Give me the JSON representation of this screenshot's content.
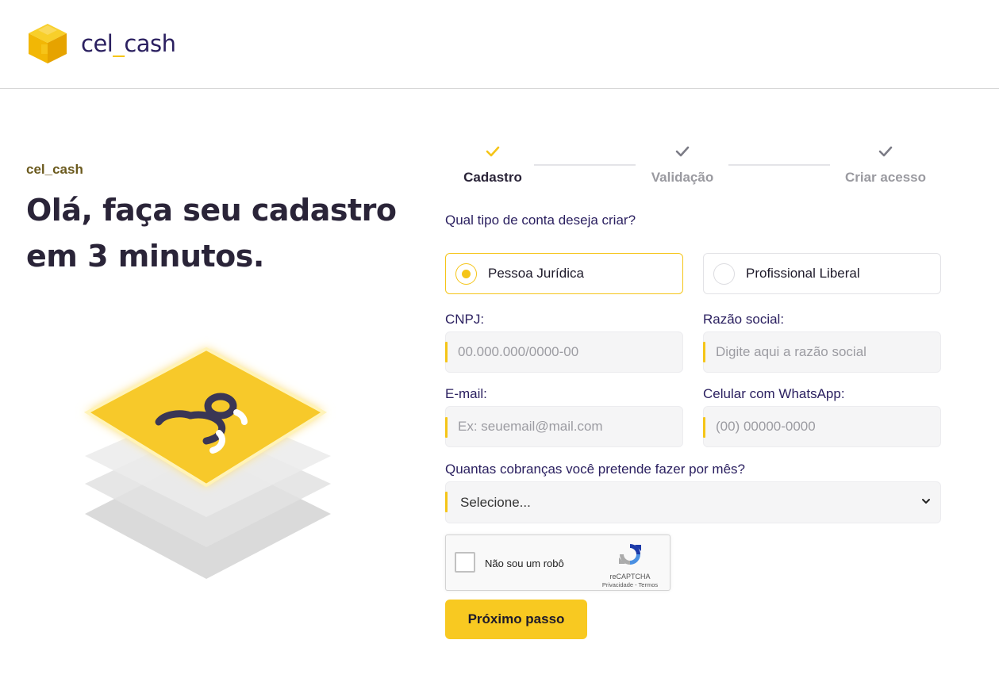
{
  "header": {
    "logo": {
      "text_left": "cel",
      "text_sep": "_",
      "text_right": "cash",
      "icon": "cube-logo-icon",
      "brand_color": "#f5c518"
    }
  },
  "hero": {
    "eyebrow": "cel_cash",
    "headline_line1": "Olá, faça seu cadastro",
    "headline_line2": "em 3 minutos.",
    "illustration": "stacked-card-illustration"
  },
  "stepper": {
    "steps": [
      {
        "label": "Cadastro",
        "state": "active",
        "icon": "check-icon"
      },
      {
        "label": "Validação",
        "state": "inactive",
        "icon": "check-icon"
      },
      {
        "label": "Criar acesso",
        "state": "inactive",
        "icon": "check-icon"
      }
    ]
  },
  "form": {
    "account_type_question": "Qual tipo de conta deseja criar?",
    "account_types": [
      {
        "label": "Pessoa Jurídica",
        "selected": true
      },
      {
        "label": "Profissional Liberal",
        "selected": false
      }
    ],
    "cnpj": {
      "label": "CNPJ:",
      "placeholder": "00.000.000/0000-00",
      "value": ""
    },
    "razao_social": {
      "label": "Razão social:",
      "placeholder": "Digite aqui a razão social",
      "value": ""
    },
    "email": {
      "label": "E-mail:",
      "placeholder": "Ex: seuemail@mail.com",
      "value": ""
    },
    "celular": {
      "label": "Celular com WhatsApp:",
      "placeholder": "(00) 00000-0000",
      "value": ""
    },
    "cobrancas": {
      "label": "Quantas cobranças você pretende fazer por mês?",
      "selected": "Selecione..."
    },
    "captcha": {
      "label": "Não sou um robô",
      "brand": "reCAPTCHA",
      "links": "Privacidade - Termos"
    },
    "submit_label": "Próximo passo"
  },
  "colors": {
    "accent": "#f5c518",
    "text_dark": "#2a2438",
    "text_navy": "#2b2060",
    "muted": "#9a9aa0"
  }
}
